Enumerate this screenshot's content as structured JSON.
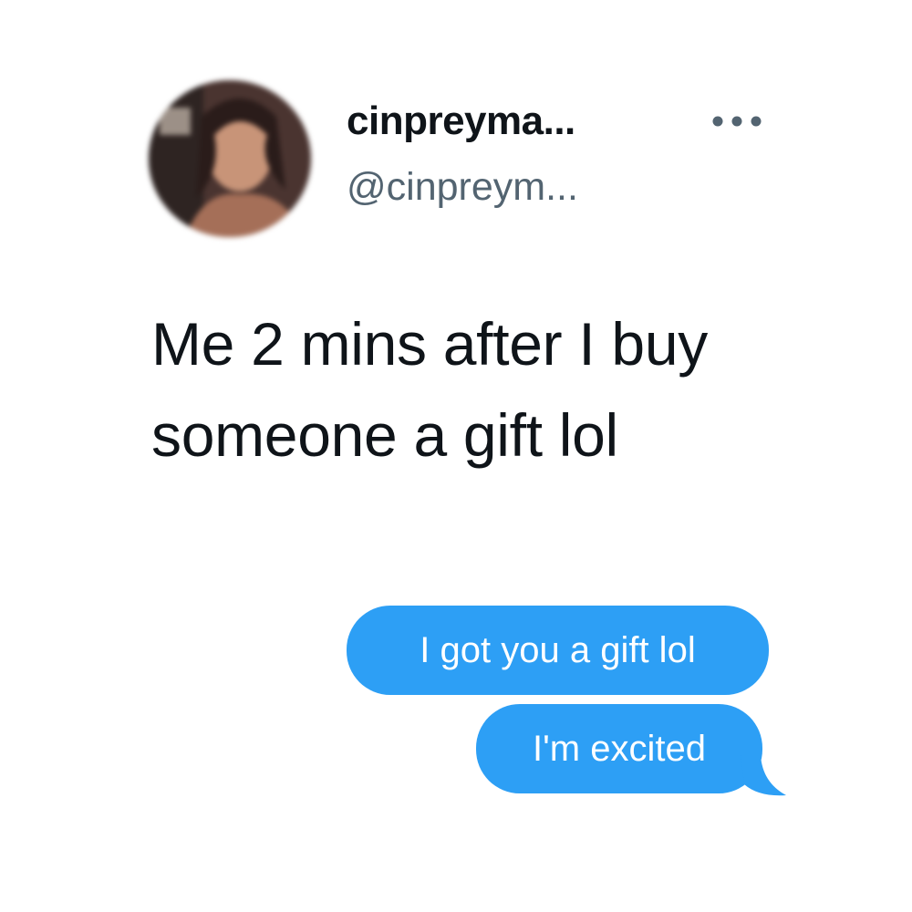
{
  "tweet": {
    "display_name": "cinpreyma...",
    "handle": "@cinpreym...",
    "avatar_icon": "profile-photo-blurred",
    "more_icon": "more-horizontal-icon",
    "text": "Me 2 mins after I buy someone a gift lol"
  },
  "messages": [
    {
      "text": "I got you a gift lol",
      "direction": "outgoing"
    },
    {
      "text": "I'm excited",
      "direction": "outgoing"
    }
  ],
  "colors": {
    "background": "#ffffff",
    "primary_text": "#0f1419",
    "secondary_text": "#536471",
    "bubble": "#2d9ff5",
    "bubble_text": "#ffffff"
  }
}
